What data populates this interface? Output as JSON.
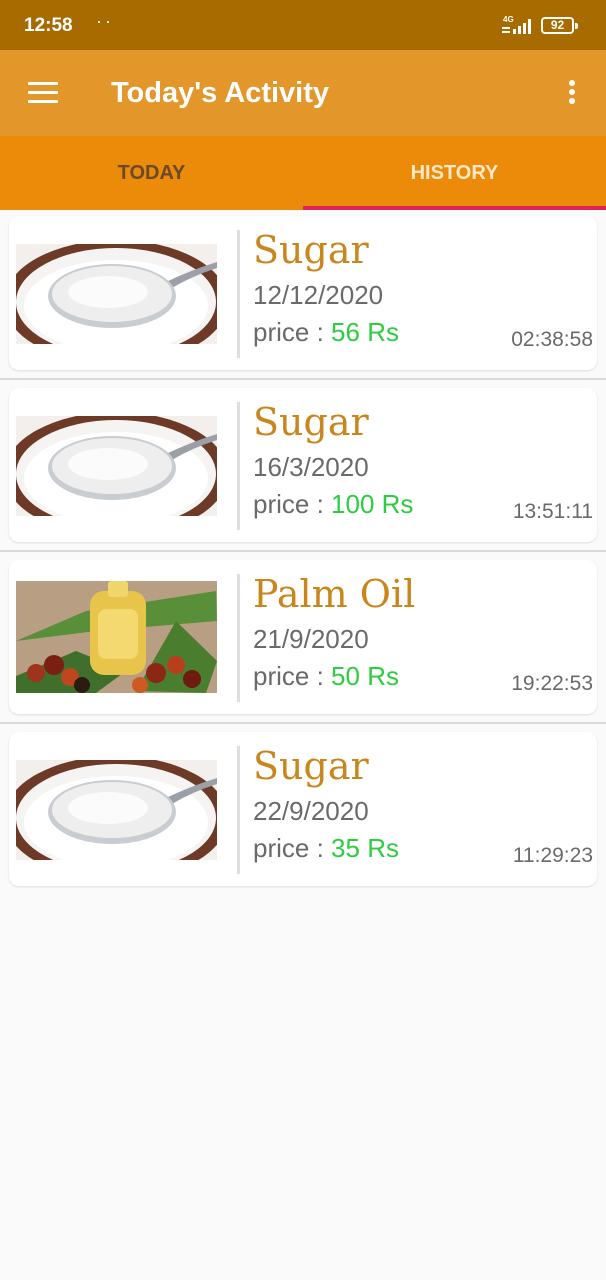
{
  "status_bar": {
    "time": "12:58",
    "notification_dots": "··",
    "network_label": "4G",
    "battery": "92"
  },
  "app_bar": {
    "title": "Today's Activity",
    "menu_icon": "hamburger-menu-icon",
    "overflow_icon": "more-vert-icon",
    "background_color": "#e3962a"
  },
  "tabs": [
    {
      "label": "TODAY",
      "selected": false
    },
    {
      "label": "HISTORY",
      "selected": true
    }
  ],
  "colors": {
    "status_bar": "#a86b00",
    "tab_bar": "#ec8a0a",
    "tab_indicator": "#e0245a",
    "item_name": "#c8861c",
    "price_value": "#2ecc40"
  },
  "history": [
    {
      "image": "sugar-spoon",
      "name": "Sugar",
      "date": "12/12/2020",
      "price_label": "price :",
      "price_value": "56 Rs",
      "time": "02:38:58"
    },
    {
      "image": "sugar-spoon",
      "name": "Sugar",
      "date": "16/3/2020",
      "price_label": "price :",
      "price_value": "100 Rs",
      "time": "13:51:11"
    },
    {
      "image": "palm-oil",
      "name": "Palm Oil",
      "date": "21/9/2020",
      "price_label": "price :",
      "price_value": "50 Rs",
      "time": "19:22:53"
    },
    {
      "image": "sugar-spoon",
      "name": "Sugar",
      "date": "22/9/2020",
      "price_label": "price :",
      "price_value": "35 Rs",
      "time": "11:29:23"
    }
  ]
}
